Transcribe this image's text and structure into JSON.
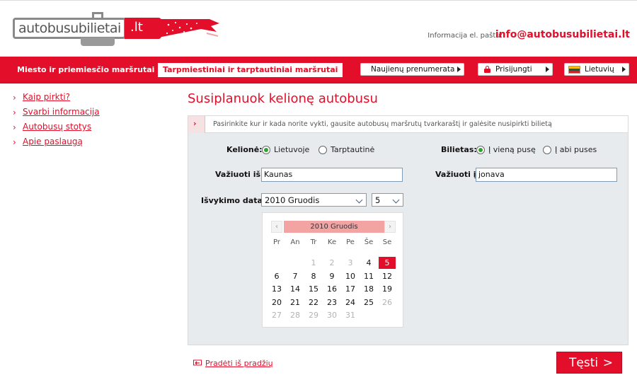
{
  "header": {
    "logo_text": "autobusubilietai",
    "logo_tld": ".lt",
    "info_label": "Informacija el. paštu:",
    "info_email": "info@autobusubilietai.lt"
  },
  "nav": {
    "local_routes": "Miesto ir priemiesčio maršrutai",
    "intercity_routes": "Tarpmiestiniai ir tarptautiniai maršrutai",
    "newsletter": "Naujienų prenumerata",
    "login": "Prisijungti",
    "language": "Lietuvių"
  },
  "sidebar": {
    "items": [
      {
        "label": "Kaip pirkti?"
      },
      {
        "label": "Svarbi informacija"
      },
      {
        "label": "Autobusų stotys"
      },
      {
        "label": "Apie paslaugą"
      }
    ]
  },
  "main": {
    "title": "Susiplanuok kelionę autobusu",
    "hint": "Pasirinkite kur ir kada norite vykti, gausite autobusų maršrutų tvarkaraštį ir galėsite nusipirkti bilietą"
  },
  "form": {
    "trip_label": "Kelionė:",
    "trip_options": [
      {
        "label": "Lietuvoje",
        "selected": true
      },
      {
        "label": "Tarptautinė",
        "selected": false
      }
    ],
    "ticket_label": "Bilietas:",
    "ticket_options": [
      {
        "label": "Į vieną pusę",
        "selected": true
      },
      {
        "label": "Į abi puses",
        "selected": false
      }
    ],
    "from_label": "Važiuoti iš:",
    "from_value": "Kaunas",
    "to_label": "Važiuoti į:",
    "to_value": "jonava",
    "date_label": "Išvykimo data:",
    "month_value": "2010 Gruodis",
    "day_value": "5"
  },
  "calendar": {
    "month": "2010 Gruodis",
    "prev": "‹",
    "next": "›",
    "weekdays": [
      "Pr",
      "An",
      "Tr",
      "Ke",
      "Pe",
      "Še",
      "Se"
    ],
    "weeks": [
      [
        "",
        "",
        "1",
        "2",
        "3",
        "4",
        "5"
      ],
      [
        "6",
        "7",
        "8",
        "9",
        "10",
        "11",
        "12"
      ],
      [
        "13",
        "14",
        "15",
        "16",
        "17",
        "18",
        "19"
      ],
      [
        "20",
        "21",
        "22",
        "23",
        "24",
        "25",
        "26"
      ],
      [
        "27",
        "28",
        "29",
        "30",
        "31",
        "",
        ""
      ]
    ],
    "selected_day": "5",
    "unavailable_days": [
      "1",
      "2",
      "3",
      "26",
      "27",
      "28",
      "29",
      "30",
      "31"
    ]
  },
  "footer": {
    "restart": "Pradėti iš pradžių",
    "continue": "Tęsti",
    "continue_arrow": ">"
  },
  "colors": {
    "brand": "#e30f2a",
    "panel_bg": "#e8ebee",
    "calendar_header": "#f4a3a3",
    "radio_on": "#33a033"
  }
}
